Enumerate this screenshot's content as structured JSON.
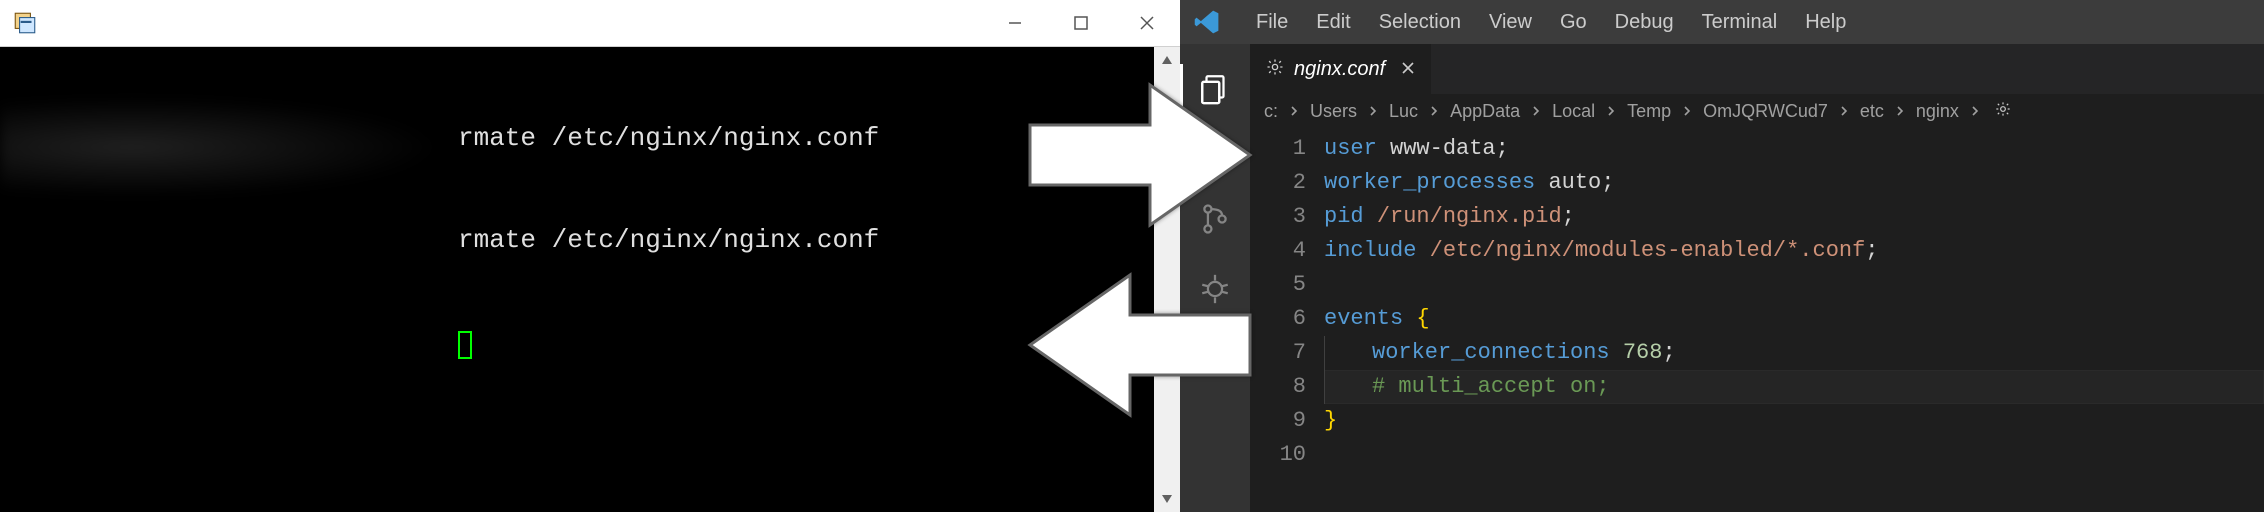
{
  "putty": {
    "title": "",
    "lines": [
      "rmate /etc/nginx/nginx.conf",
      "rmate /etc/nginx/nginx.conf"
    ]
  },
  "vscode": {
    "menu": [
      "File",
      "Edit",
      "Selection",
      "View",
      "Go",
      "Debug",
      "Terminal",
      "Help"
    ],
    "activity": [
      {
        "name": "explorer-icon",
        "active": true
      },
      {
        "name": "search-icon",
        "active": false
      },
      {
        "name": "source-control-icon",
        "active": false
      },
      {
        "name": "debug-icon",
        "active": false
      },
      {
        "name": "extensions-icon",
        "active": false
      }
    ],
    "tab": {
      "filename": "nginx.conf"
    },
    "breadcrumb": [
      "c:",
      "Users",
      "Luc",
      "AppData",
      "Local",
      "Temp",
      "OmJQRWCud7",
      "etc",
      "nginx"
    ],
    "code": {
      "lines": [
        {
          "n": 1,
          "tokens": [
            [
              "dir",
              "user"
            ],
            [
              "sp",
              " "
            ],
            [
              "white",
              "www-data"
            ],
            [
              "punc",
              ";"
            ]
          ]
        },
        {
          "n": 2,
          "tokens": [
            [
              "dir",
              "worker_processes"
            ],
            [
              "sp",
              " "
            ],
            [
              "white",
              "auto"
            ],
            [
              "punc",
              ";"
            ]
          ]
        },
        {
          "n": 3,
          "tokens": [
            [
              "dir",
              "pid"
            ],
            [
              "sp",
              " "
            ],
            [
              "path",
              "/run/nginx.pid"
            ],
            [
              "punc",
              ";"
            ]
          ]
        },
        {
          "n": 4,
          "tokens": [
            [
              "dir",
              "include"
            ],
            [
              "sp",
              " "
            ],
            [
              "path",
              "/etc/nginx/modules-enabled/*.conf"
            ],
            [
              "punc",
              ";"
            ]
          ]
        },
        {
          "n": 5,
          "tokens": []
        },
        {
          "n": 6,
          "tokens": [
            [
              "dir",
              "events"
            ],
            [
              "sp",
              " "
            ],
            [
              "brace",
              "{"
            ]
          ]
        },
        {
          "n": 7,
          "tokens": [
            [
              "indent",
              "    "
            ],
            [
              "dir",
              "worker_connections"
            ],
            [
              "sp",
              " "
            ],
            [
              "num",
              "768"
            ],
            [
              "punc",
              ";"
            ]
          ]
        },
        {
          "n": 8,
          "tokens": [
            [
              "indent",
              "    "
            ],
            [
              "comment",
              "# multi_accept on;"
            ]
          ]
        },
        {
          "n": 9,
          "tokens": [
            [
              "brace",
              "}"
            ]
          ]
        },
        {
          "n": 10,
          "tokens": []
        }
      ],
      "current_line": 8
    }
  }
}
